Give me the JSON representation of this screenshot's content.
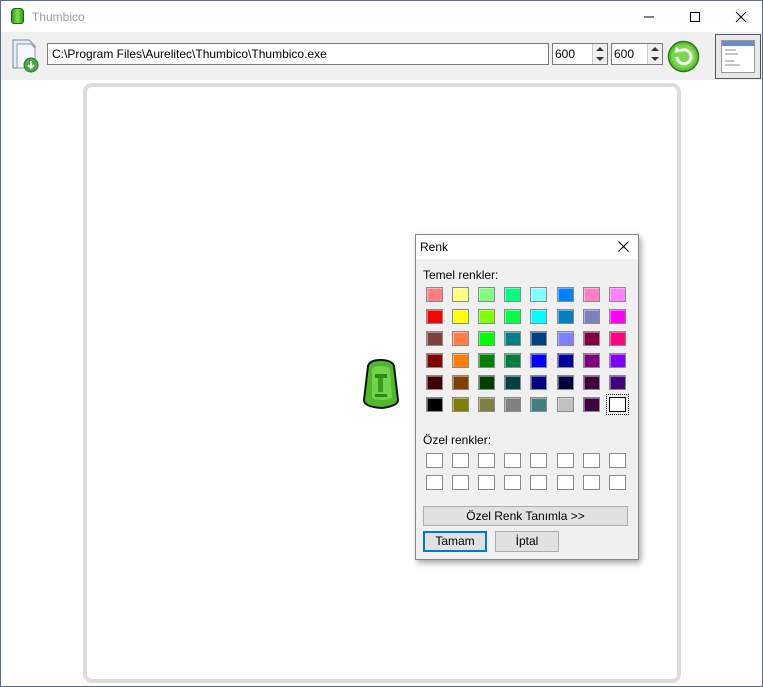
{
  "window": {
    "title": "Thumbico"
  },
  "toolbar": {
    "file_path": "C:\\Program Files\\Aurelitec\\Thumbico\\Thumbico.exe",
    "width_value": "600",
    "height_value": "600",
    "open_icon": "document-open-icon",
    "refresh_icon": "refresh-green-icon",
    "thumbnail_icon": "window-thumbnail-icon"
  },
  "dialog": {
    "title": "Renk",
    "basic_label": "Temel renkler:",
    "custom_label": "Özel renkler:",
    "define_button": "Özel Renk Tanımla >>",
    "ok_button": "Tamam",
    "cancel_button": "İptal",
    "selected_color": "#FFFFFF",
    "basic_colors": [
      "#FF8080",
      "#FFFF80",
      "#80FF80",
      "#00FF80",
      "#80FFFF",
      "#0080FF",
      "#FF80C0",
      "#FF80FF",
      "#FF0000",
      "#FFFF00",
      "#80FF00",
      "#00FF40",
      "#00FFFF",
      "#0080C0",
      "#8080C0",
      "#FF00FF",
      "#804040",
      "#FF8040",
      "#00FF00",
      "#008080",
      "#004080",
      "#8080FF",
      "#800040",
      "#FF0080",
      "#800000",
      "#FF8000",
      "#008000",
      "#008040",
      "#0000FF",
      "#0000A0",
      "#800080",
      "#8000FF",
      "#400000",
      "#804000",
      "#004000",
      "#004040",
      "#000080",
      "#000040",
      "#400040",
      "#400080",
      "#000000",
      "#808000",
      "#808040",
      "#808080",
      "#408080",
      "#C0C0C0",
      "#400040",
      "#FFFFFF"
    ],
    "custom_colors": [
      "#FFFFFF",
      "#FFFFFF",
      "#FFFFFF",
      "#FFFFFF",
      "#FFFFFF",
      "#FFFFFF",
      "#FFFFFF",
      "#FFFFFF",
      "#FFFFFF",
      "#FFFFFF",
      "#FFFFFF",
      "#FFFFFF",
      "#FFFFFF",
      "#FFFFFF",
      "#FFFFFF",
      "#FFFFFF"
    ]
  },
  "preview": {
    "icon": "moai-green-icon"
  }
}
